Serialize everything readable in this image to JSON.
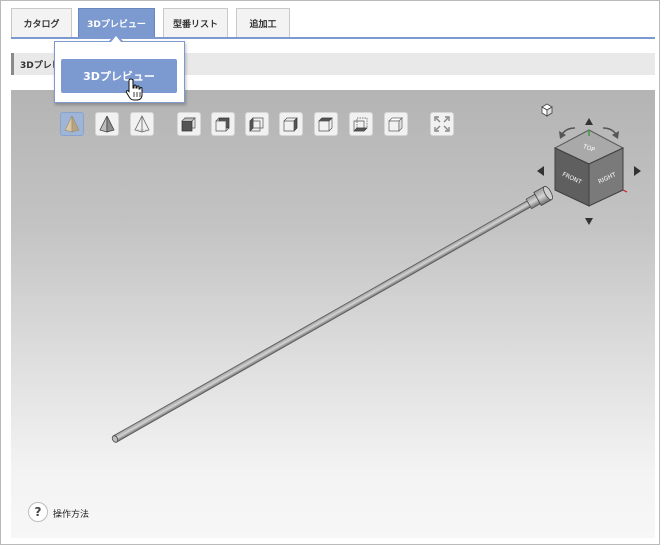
{
  "tabs": [
    {
      "label": "カタログ"
    },
    {
      "label": "3Dプレビュー"
    },
    {
      "label": "型番リスト"
    },
    {
      "label": "追加工"
    }
  ],
  "section": {
    "title": "3Dプレビュー"
  },
  "popup": {
    "button_label": "3Dプレビュー"
  },
  "view_cube": {
    "top": "TOP",
    "front": "FRONT",
    "right": "RIGHT"
  },
  "help": {
    "icon": "?",
    "label": "操作方法"
  },
  "toolbar_icons": [
    "shaded-pyramid-icon",
    "shaded-edges-pyramid-icon",
    "wireframe-pyramid-icon",
    "front-view-icon",
    "back-view-icon",
    "left-view-icon",
    "right-view-icon",
    "top-view-icon",
    "bottom-view-icon",
    "iso-view-icon",
    "fit-view-icon"
  ],
  "colors": {
    "accent": "#7d9ad0",
    "selected": "#9eb5d8"
  }
}
